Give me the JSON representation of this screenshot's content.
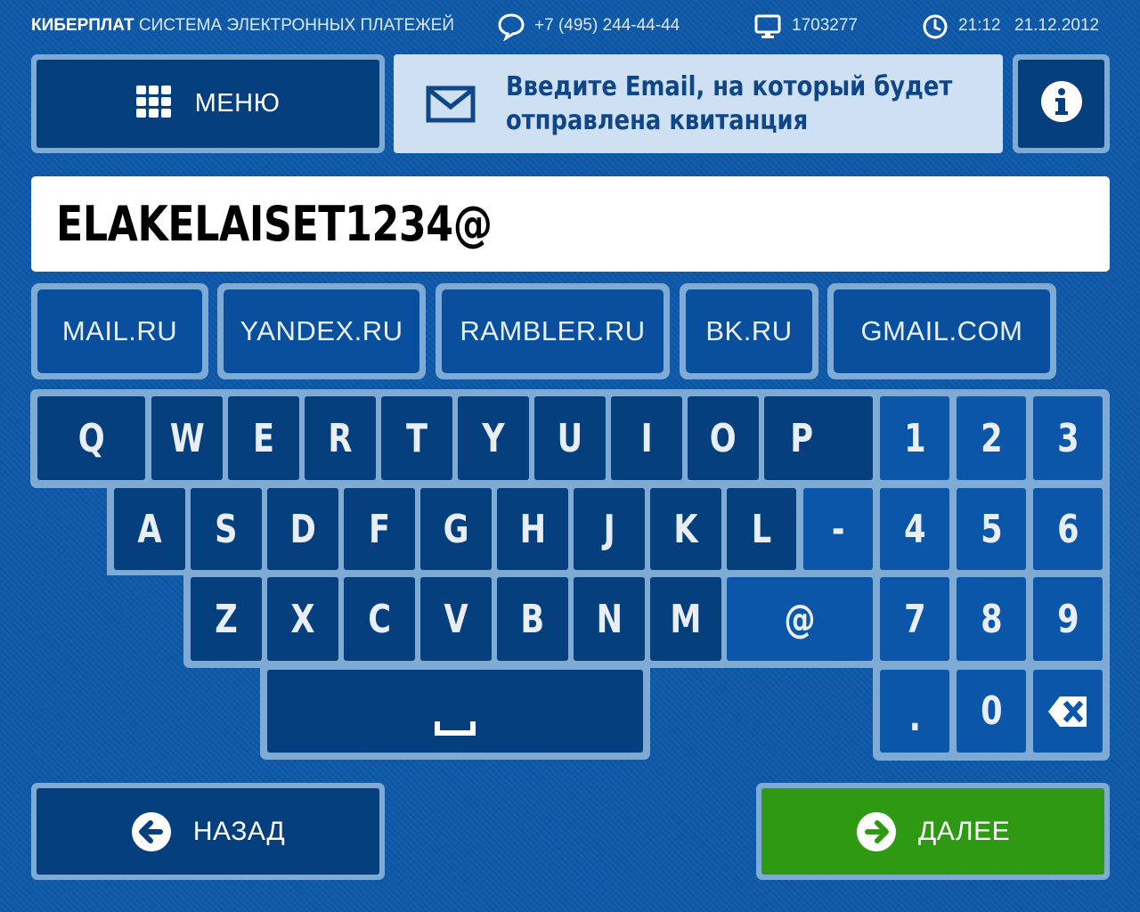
{
  "header": {
    "brand": "КИБЕРПЛАТ",
    "system_name": "СИСТЕМА ЭЛЕКТРОННЫХ ПЛАТЕЖЕЙ",
    "phone": "+7 (495) 244-44-44",
    "terminal_id": "1703277",
    "time": "21:12",
    "date": "21.12.2012",
    "icons": [
      "speech-bubble-icon",
      "monitor-icon",
      "clock-icon"
    ]
  },
  "toolbar": {
    "menu_label": "МЕНЮ",
    "prompt_line1": "Введите Email, на который будет",
    "prompt_line2": "отправлена квитанция",
    "icons": [
      "grid-icon",
      "envelope-icon",
      "info-icon"
    ]
  },
  "email": {
    "value": "ELAKELAISET1234@"
  },
  "domains": [
    "MAIL.RU",
    "YANDEX.RU",
    "RAMBLER.RU",
    "BK.RU",
    "GMAIL.COM"
  ],
  "keyboard": {
    "row1": [
      "Q",
      "W",
      "E",
      "R",
      "T",
      "Y",
      "U",
      "I",
      "O",
      "P"
    ],
    "row2": [
      "A",
      "S",
      "D",
      "F",
      "G",
      "H",
      "J",
      "K",
      "L",
      "-"
    ],
    "row3": [
      "Z",
      "X",
      "C",
      "V",
      "B",
      "N",
      "M",
      "@"
    ],
    "numpad": [
      "1",
      "2",
      "3",
      "4",
      "5",
      "6",
      "7",
      "8",
      "9",
      ".",
      "0"
    ],
    "space_icon": "space-bar-icon",
    "backspace_icon": "backspace-icon"
  },
  "footer": {
    "back_label": "НАЗАД",
    "next_label": "ДАЛЕЕ",
    "icons": [
      "arrow-left-circle-icon",
      "arrow-right-circle-icon"
    ]
  },
  "colors": {
    "background": "#0d58a8",
    "key_dark": "#063f7e",
    "key_light": "#0b56a8",
    "frame": "#7eaad4",
    "prompt_bg": "#cfe0f2",
    "prompt_text": "#0e4688",
    "next_button": "#2e9a13"
  }
}
